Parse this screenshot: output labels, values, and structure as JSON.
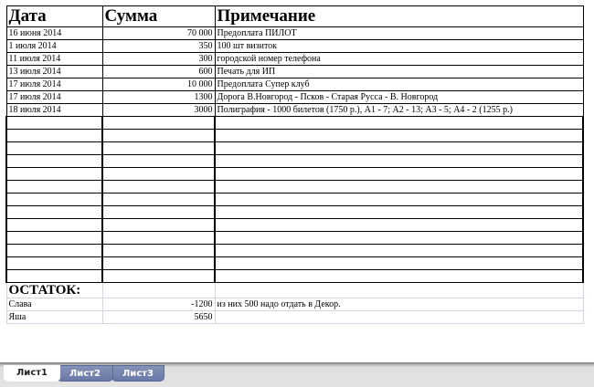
{
  "headers": {
    "date": "Дата",
    "sum": "Сумма",
    "note": "Примечание"
  },
  "rows": [
    {
      "date": "16 июня 2014",
      "sum": "70 000",
      "note": "Предоплата ПИЛОТ"
    },
    {
      "date": "1 июля 2014",
      "sum": "350",
      "note": "100 шт визиток"
    },
    {
      "date": "11 июля 2014",
      "sum": "300",
      "note": "городской номер телефона"
    },
    {
      "date": "13 июля 2014",
      "sum": "600",
      "note": "Печать для ИП"
    },
    {
      "date": "17 июля 2014",
      "sum": "10 000",
      "note": "Предоплата Супер клуб"
    },
    {
      "date": "17 июля 2014",
      "sum": "1300",
      "note": "Дорога В.Новгород - Псков - Старая Русса - В. Новгород"
    },
    {
      "date": "18 июля 2014",
      "sum": "3000",
      "note": "Полиграфия - 1000 билетов (1750 р.), А1 - 7; А2 - 13; А3 - 5; А4 - 2 (1255 р.)"
    }
  ],
  "balance": {
    "title": "ОСТАТОК:",
    "rows": [
      {
        "name": "Слава",
        "sum": "-1200",
        "note": "из них 500 надо отдать в Декор."
      },
      {
        "name": "Яша",
        "sum": "5650",
        "note": ""
      }
    ]
  },
  "tabs": [
    "Лист1",
    "Лист2",
    "Лист3"
  ]
}
